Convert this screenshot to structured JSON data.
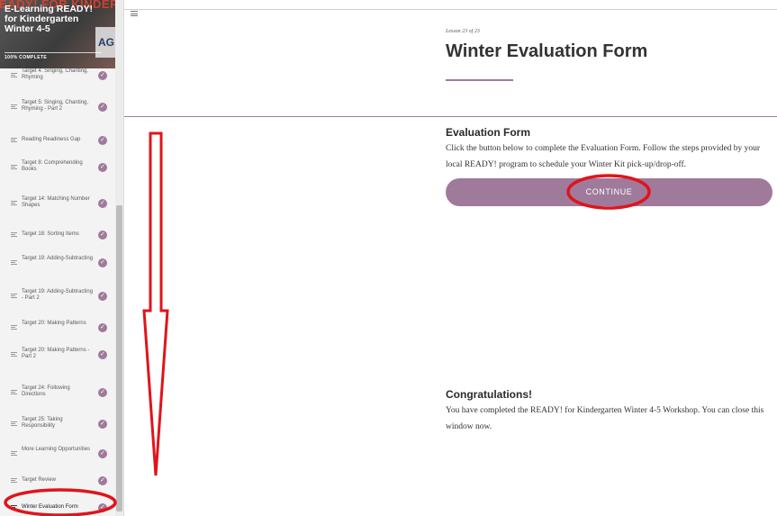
{
  "sidebar": {
    "course_title": "E-Learning READY! for Kindergarten Winter 4-5",
    "progress_text": "100% COMPLETE",
    "banner_deco": "READY! FOR KINDER",
    "banner_deco2": "AG",
    "items": [
      {
        "label": "Target 4: Singing, Chanting, Rhyming"
      },
      {
        "label": "Target 5: Singing, Chanting, Rhyming - Part 2"
      },
      {
        "label": "Reading Readiness Gap"
      },
      {
        "label": "Target 8: Comprehending Books"
      },
      {
        "label": "Target 14: Matching Number Shapes"
      },
      {
        "label": "Target 18: Sorting Items"
      },
      {
        "label": "Target 19: Adding-Subtracting"
      },
      {
        "label": "Target 19: Adding-Subtracting - Part 2"
      },
      {
        "label": "Target 20: Making Patterns"
      },
      {
        "label": "Target 20: Making Patterns - Part 2"
      },
      {
        "label": "Target 24: Following Directions"
      },
      {
        "label": "Target 25: Taking Responsibility"
      },
      {
        "label": "More Learning Opportunities"
      },
      {
        "label": "Target Review"
      },
      {
        "label": "Winter Evaluation Form"
      }
    ],
    "check_glyph": "✓"
  },
  "main": {
    "lesson_count": "Lesson 23 of 23",
    "title": "Winter Evaluation Form",
    "evaluation": {
      "heading": "Evaluation Form",
      "text": "Click the button below to complete the Evaluation Form. Follow the steps provided by your local READY! program to schedule your Winter Kit pick-up/drop-off.",
      "button_label": "CONTINUE"
    },
    "congrats": {
      "heading": "Congratulations!",
      "text": "You have completed the READY! for Kindergarten Winter 4-5 Workshop. You can close this window now."
    }
  },
  "colors": {
    "accent": "#9f7a9a",
    "annotation_red": "#e0141b"
  },
  "icons": {
    "menu": "hamburger-menu-icon",
    "lesson": "lesson-lines-icon",
    "complete": "check-circle-icon"
  }
}
